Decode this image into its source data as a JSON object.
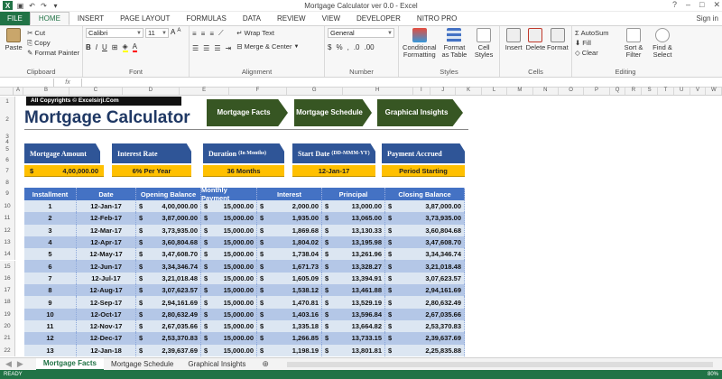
{
  "window": {
    "title": "Mortgage Calculator ver 0.0 - Excel",
    "signin": "Sign in"
  },
  "tabs": [
    "FILE",
    "HOME",
    "INSERT",
    "PAGE LAYOUT",
    "FORMULAS",
    "DATA",
    "REVIEW",
    "VIEW",
    "DEVELOPER",
    "NITRO PRO"
  ],
  "ribbon": {
    "clipboard": {
      "paste": "Paste",
      "cut": "Cut",
      "copy": "Copy",
      "painter": "Format Painter",
      "label": "Clipboard"
    },
    "font": {
      "name": "Calibri",
      "size": "11",
      "label": "Font"
    },
    "alignment": {
      "wrap": "Wrap Text",
      "merge": "Merge & Center",
      "label": "Alignment"
    },
    "number": {
      "format": "General",
      "label": "Number"
    },
    "styles": {
      "conditional": "Conditional Formatting",
      "table": "Format as Table",
      "cell": "Cell Styles",
      "label": "Styles"
    },
    "cells": {
      "insert": "Insert",
      "delete": "Delete",
      "format": "Format",
      "label": "Cells"
    },
    "editing": {
      "autosum": "AutoSum",
      "fill": "Fill",
      "clear": "Clear",
      "sort": "Sort & Filter",
      "find": "Find & Select",
      "label": "Editing"
    }
  },
  "columns": [
    "A",
    "B",
    "C",
    "D",
    "E",
    "F",
    "G",
    "H",
    "I",
    "J",
    "K",
    "L",
    "M",
    "N",
    "O",
    "P",
    "Q",
    "R",
    "S",
    "T",
    "U",
    "V",
    "W"
  ],
  "rows": [
    "1",
    "2",
    "3",
    "4",
    "5",
    "6",
    "7",
    "8",
    "9",
    "10",
    "11",
    "12",
    "13",
    "14",
    "15",
    "16",
    "17",
    "18",
    "19",
    "20",
    "21",
    "22"
  ],
  "sheet": {
    "copyright": "All Copyrights © Excelsirji.Com",
    "title": "Mortgage Calculator",
    "nav": [
      "Mortgage Facts",
      "Mortgage Schedule",
      "Graphical Insights"
    ],
    "facts": [
      {
        "label": "Mortgage Amount",
        "small": "",
        "currency": "$",
        "value": "4,00,000.00"
      },
      {
        "label": "Interest Rate",
        "small": "",
        "currency": "",
        "value": "6% Per Year"
      },
      {
        "label": "Duration",
        "small": "(In Months)",
        "currency": "",
        "value": "36 Months"
      },
      {
        "label": "Start Date",
        "small": "(DD-MMM-YY)",
        "currency": "",
        "value": "12-Jan-17"
      },
      {
        "label": "Payment Accrued",
        "small": "",
        "currency": "",
        "value": "Period Starting"
      }
    ],
    "headers": [
      "Installment",
      "Date",
      "Opening Balance",
      "Monthly Payment",
      "Interest",
      "Principal",
      "Closing Balance"
    ],
    "currency": "$",
    "rows": [
      [
        "1",
        "12-Jan-17",
        "4,00,000.00",
        "15,000.00",
        "2,000.00",
        "13,000.00",
        "3,87,000.00"
      ],
      [
        "2",
        "12-Feb-17",
        "3,87,000.00",
        "15,000.00",
        "1,935.00",
        "13,065.00",
        "3,73,935.00"
      ],
      [
        "3",
        "12-Mar-17",
        "3,73,935.00",
        "15,000.00",
        "1,869.68",
        "13,130.33",
        "3,60,804.68"
      ],
      [
        "4",
        "12-Apr-17",
        "3,60,804.68",
        "15,000.00",
        "1,804.02",
        "13,195.98",
        "3,47,608.70"
      ],
      [
        "5",
        "12-May-17",
        "3,47,608.70",
        "15,000.00",
        "1,738.04",
        "13,261.96",
        "3,34,346.74"
      ],
      [
        "6",
        "12-Jun-17",
        "3,34,346.74",
        "15,000.00",
        "1,671.73",
        "13,328.27",
        "3,21,018.48"
      ],
      [
        "7",
        "12-Jul-17",
        "3,21,018.48",
        "15,000.00",
        "1,605.09",
        "13,394.91",
        "3,07,623.57"
      ],
      [
        "8",
        "12-Aug-17",
        "3,07,623.57",
        "15,000.00",
        "1,538.12",
        "13,461.88",
        "2,94,161.69"
      ],
      [
        "9",
        "12-Sep-17",
        "2,94,161.69",
        "15,000.00",
        "1,470.81",
        "13,529.19",
        "2,80,632.49"
      ],
      [
        "10",
        "12-Oct-17",
        "2,80,632.49",
        "15,000.00",
        "1,403.16",
        "13,596.84",
        "2,67,035.66"
      ],
      [
        "11",
        "12-Nov-17",
        "2,67,035.66",
        "15,000.00",
        "1,335.18",
        "13,664.82",
        "2,53,370.83"
      ],
      [
        "12",
        "12-Dec-17",
        "2,53,370.83",
        "15,000.00",
        "1,266.85",
        "13,733.15",
        "2,39,637.69"
      ],
      [
        "13",
        "12-Jan-18",
        "2,39,637.69",
        "15,000.00",
        "1,198.19",
        "13,801.81",
        "2,25,835.88"
      ]
    ]
  },
  "sheettabs": [
    "Mortgage Facts",
    "Mortgage Schedule",
    "Graphical Insights"
  ],
  "status": {
    "left": "READY",
    "zoom": "80%"
  }
}
